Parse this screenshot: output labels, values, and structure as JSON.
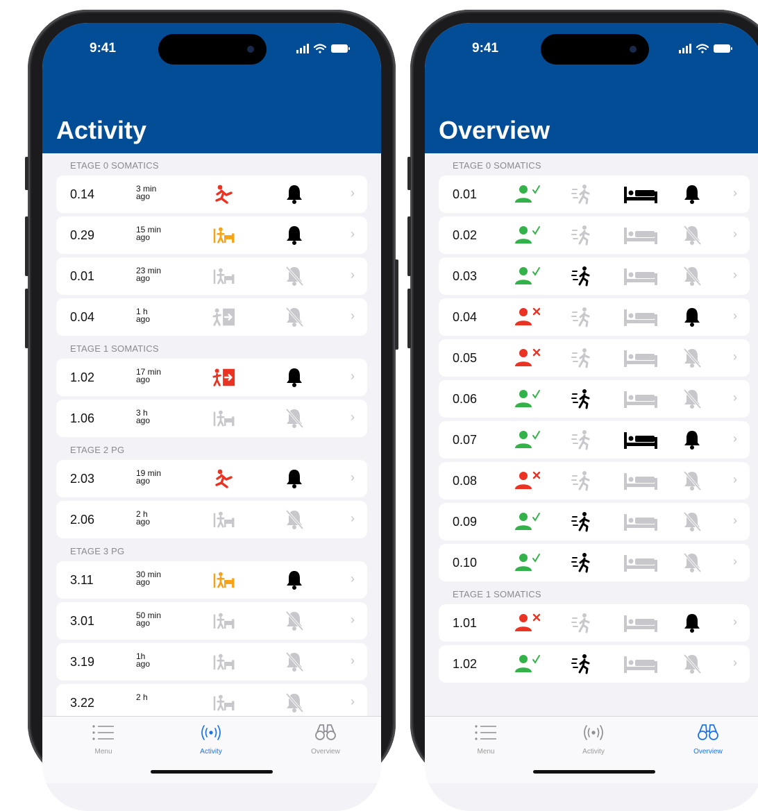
{
  "status_time": "9:41",
  "colors": {
    "accent": "#034d96",
    "alert_red": "#ea3323",
    "alert_orange": "#f7a319",
    "ok_green": "#33b249",
    "inactive": "#c8c8cc"
  },
  "activity": {
    "title": "Activity",
    "sections": [
      {
        "header": "ETAGE 0 SOMATICS",
        "rows": [
          {
            "room": "0.14",
            "ago_value": "3 min",
            "ago_unit": "ago",
            "event": "fall",
            "event_color": "red",
            "bell": "on"
          },
          {
            "room": "0.29",
            "ago_value": "15 min",
            "ago_unit": "ago",
            "event": "leave-bed",
            "event_color": "orange",
            "bell": "on"
          },
          {
            "room": "0.01",
            "ago_value": "23 min",
            "ago_unit": "ago",
            "event": "leave-bed",
            "event_color": "grey",
            "bell": "off"
          },
          {
            "room": "0.04",
            "ago_value": "1 h",
            "ago_unit": "ago",
            "event": "exit-room",
            "event_color": "grey",
            "bell": "off"
          }
        ]
      },
      {
        "header": "ETAGE 1 SOMATICS",
        "rows": [
          {
            "room": "1.02",
            "ago_value": "17 min",
            "ago_unit": "ago",
            "event": "exit-room",
            "event_color": "red",
            "bell": "on"
          },
          {
            "room": "1.06",
            "ago_value": "3 h",
            "ago_unit": "ago",
            "event": "leave-bed",
            "event_color": "grey",
            "bell": "off"
          }
        ]
      },
      {
        "header": "ETAGE 2 PG",
        "rows": [
          {
            "room": "2.03",
            "ago_value": "19 min",
            "ago_unit": "ago",
            "event": "fall",
            "event_color": "red",
            "bell": "on"
          },
          {
            "room": "2.06",
            "ago_value": "2 h",
            "ago_unit": "ago",
            "event": "leave-bed",
            "event_color": "grey",
            "bell": "off"
          }
        ]
      },
      {
        "header": "ETAGE 3 PG",
        "rows": [
          {
            "room": "3.11",
            "ago_value": "30 min",
            "ago_unit": "ago",
            "event": "leave-bed",
            "event_color": "orange",
            "bell": "on"
          },
          {
            "room": "3.01",
            "ago_value": "50 min",
            "ago_unit": "ago",
            "event": "leave-bed",
            "event_color": "grey",
            "bell": "off"
          },
          {
            "room": "3.19",
            "ago_value": "1h",
            "ago_unit": "ago",
            "event": "leave-bed",
            "event_color": "grey",
            "bell": "off"
          },
          {
            "room": "3.22",
            "ago_value": "2 h",
            "ago_unit": "",
            "event": "leave-bed",
            "event_color": "grey",
            "bell": "off"
          }
        ]
      }
    ],
    "tabs": [
      {
        "label": "Menu",
        "icon": "list-icon",
        "active": false
      },
      {
        "label": "Activity",
        "icon": "broadcast-icon",
        "active": true
      },
      {
        "label": "Overview",
        "icon": "binoculars-icon",
        "active": false
      }
    ]
  },
  "overview": {
    "title": "Overview",
    "sections": [
      {
        "header": "ETAGE 0 SOMATICS",
        "rows": [
          {
            "room": "0.01",
            "person": "present",
            "walk": false,
            "bed": true,
            "bell": "on"
          },
          {
            "room": "0.02",
            "person": "present",
            "walk": false,
            "bed": false,
            "bell": "off"
          },
          {
            "room": "0.03",
            "person": "present",
            "walk": true,
            "bed": false,
            "bell": "off"
          },
          {
            "room": "0.04",
            "person": "absent",
            "walk": false,
            "bed": false,
            "bell": "on"
          },
          {
            "room": "0.05",
            "person": "absent",
            "walk": false,
            "bed": false,
            "bell": "off"
          },
          {
            "room": "0.06",
            "person": "present",
            "walk": true,
            "bed": false,
            "bell": "off"
          },
          {
            "room": "0.07",
            "person": "present",
            "walk": false,
            "bed": true,
            "bell": "on"
          },
          {
            "room": "0.08",
            "person": "absent",
            "walk": false,
            "bed": false,
            "bell": "off"
          },
          {
            "room": "0.09",
            "person": "present",
            "walk": true,
            "bed": false,
            "bell": "off"
          },
          {
            "room": "0.10",
            "person": "present",
            "walk": true,
            "bed": false,
            "bell": "off"
          }
        ]
      },
      {
        "header": "ETAGE 1 SOMATICS",
        "rows": [
          {
            "room": "1.01",
            "person": "absent",
            "walk": false,
            "bed": false,
            "bell": "on"
          },
          {
            "room": "1.02",
            "person": "present",
            "walk": true,
            "bed": false,
            "bell": "off"
          }
        ]
      }
    ],
    "tabs": [
      {
        "label": "Menu",
        "icon": "list-icon",
        "active": false
      },
      {
        "label": "Activity",
        "icon": "broadcast-icon",
        "active": false
      },
      {
        "label": "Overview",
        "icon": "binoculars-icon",
        "active": true
      }
    ]
  }
}
